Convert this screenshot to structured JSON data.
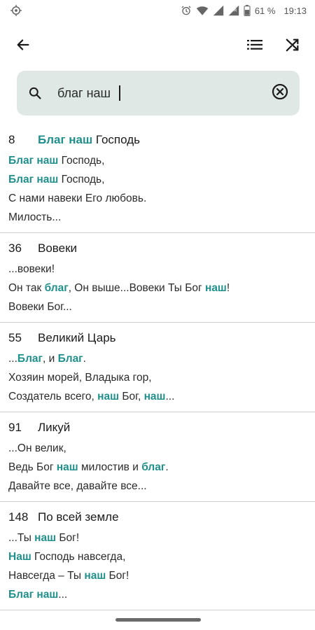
{
  "status_bar": {
    "battery": "61 %",
    "time": "19:13"
  },
  "toolbar": {
    "back_icon": "arrow-left-icon",
    "list_icon": "list-icon",
    "shuffle_icon": "shuffle-icon"
  },
  "search": {
    "value": "благ наш",
    "icon": "search-icon",
    "clear_icon": "clear-circle-icon"
  },
  "colors": {
    "highlight": "#20908c",
    "search_bg": "#dfe8e5"
  },
  "results": [
    {
      "number": "8",
      "title": "",
      "title_parts": [
        [
          "Благ наш",
          true
        ],
        [
          " Господь",
          false
        ]
      ],
      "lines": [
        [
          [
            "Благ наш",
            true
          ],
          [
            " Господь,",
            false
          ]
        ],
        [
          [
            "Благ наш",
            true
          ],
          [
            " Господь,",
            false
          ]
        ],
        [
          [
            "С нами навеки Его любовь.",
            false
          ]
        ],
        [
          [
            "Милость...",
            false
          ]
        ]
      ]
    },
    {
      "number": "36",
      "title_parts": [
        [
          "Вовеки",
          false
        ]
      ],
      "lines": [
        [
          [
            "...вовеки!",
            false
          ]
        ],
        [
          [
            "Он так ",
            false
          ],
          [
            "благ",
            true
          ],
          [
            ", Он выше...Вовеки Ты Бог ",
            false
          ],
          [
            "наш",
            true
          ],
          [
            "!",
            false
          ]
        ],
        [
          [
            "Вовеки Бог...",
            false
          ]
        ]
      ]
    },
    {
      "number": "55",
      "title_parts": [
        [
          "Великий Царь",
          false
        ]
      ],
      "lines": [
        [
          [
            "...",
            false
          ],
          [
            "Благ",
            true
          ],
          [
            ", и ",
            false
          ],
          [
            "Благ",
            true
          ],
          [
            ".",
            false
          ]
        ],
        [
          [
            "Хозяин морей, Владыка гор,",
            false
          ]
        ],
        [
          [
            "Создатель всего, ",
            false
          ],
          [
            "наш",
            true
          ],
          [
            " Бог, ",
            false
          ],
          [
            "наш",
            true
          ],
          [
            "...",
            false
          ]
        ]
      ]
    },
    {
      "number": "91",
      "title_parts": [
        [
          "Ликуй",
          false
        ]
      ],
      "lines": [
        [
          [
            "...Он велик,",
            false
          ]
        ],
        [
          [
            "Ведь Бог ",
            false
          ],
          [
            "наш",
            true
          ],
          [
            " милостив и ",
            false
          ],
          [
            "благ",
            true
          ],
          [
            ".",
            false
          ]
        ],
        [
          [
            "Давайте все, давайте все...",
            false
          ]
        ]
      ]
    },
    {
      "number": "148",
      "title_parts": [
        [
          "По всей земле",
          false
        ]
      ],
      "lines": [
        [
          [
            "...Ты ",
            false
          ],
          [
            "наш",
            true
          ],
          [
            " Бог!",
            false
          ]
        ],
        [
          [
            "Наш",
            true
          ],
          [
            " Господь навсегда,",
            false
          ]
        ],
        [
          [
            "Навсегда – Ты ",
            false
          ],
          [
            "наш",
            true
          ],
          [
            " Бог!",
            false
          ]
        ],
        [
          [
            "Благ наш",
            true
          ],
          [
            "...",
            false
          ]
        ]
      ]
    }
  ]
}
